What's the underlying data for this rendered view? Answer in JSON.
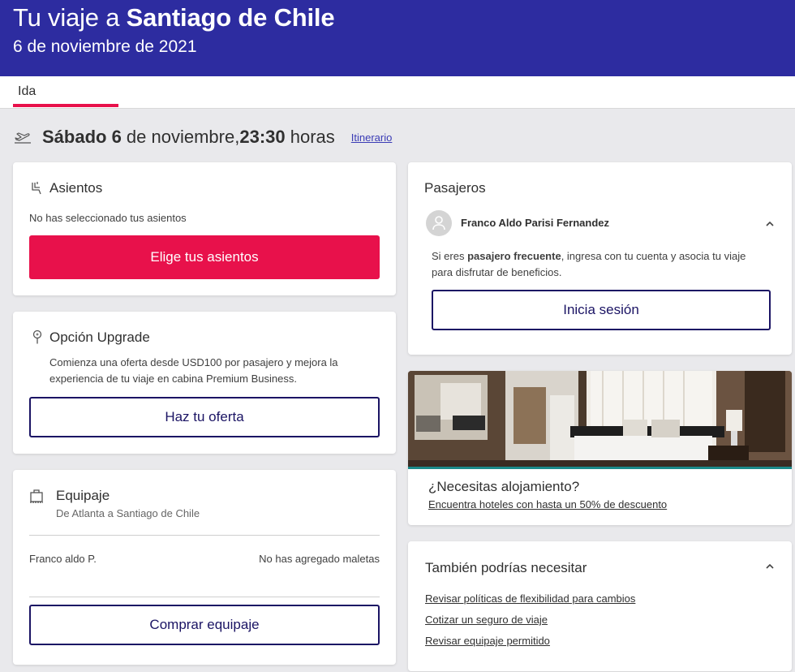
{
  "header": {
    "title_prefix": "Tu viaje a",
    "destination": "Santiago de Chile",
    "date": "6 de noviembre de 2021"
  },
  "tabs": {
    "ida": "Ida"
  },
  "flight": {
    "day": "Sábado 6",
    "month_text": " de noviembre,",
    "time": "23:30",
    "hours_label": " horas",
    "itinerary_link": "Itinerario"
  },
  "seats": {
    "title": "Asientos",
    "status": "No has seleccionado tus asientos",
    "button": "Elige tus asientos"
  },
  "upgrade": {
    "title": "Opción Upgrade",
    "description": "Comienza una oferta desde USD100 por pasajero y mejora la experiencia de tu viaje en cabina Premium Business.",
    "button": "Haz tu oferta"
  },
  "baggage": {
    "title": "Equipaje",
    "route": "De Atlanta a Santiago de Chile",
    "passenger": "Franco aldo P.",
    "status": "No has agregado maletas",
    "button": "Comprar equipaje"
  },
  "passengers": {
    "title": "Pasajeros",
    "name": "Franco Aldo Parisi Fernandez",
    "info_pre": "Si eres ",
    "info_bold": "pasajero frecuente",
    "info_post": ", ingresa con tu cuenta y asocia tu viaje para disfrutar de beneficios.",
    "button": "Inicia sesión"
  },
  "hotel": {
    "title": "¿Necesitas alojamiento?",
    "link": "Encuentra hoteles con hasta un 50% de descuento"
  },
  "extras": {
    "title": "También podrías necesitar",
    "links": [
      "Revisar políticas de flexibilidad para cambios",
      "Cotizar un seguro de viaje",
      "Revisar equipaje permitido"
    ]
  },
  "colors": {
    "header_bg": "#2d2ca0",
    "accent_pink": "#e8114b",
    "outline_navy": "#1b1464",
    "hotel_teal": "#1b8a8a"
  }
}
